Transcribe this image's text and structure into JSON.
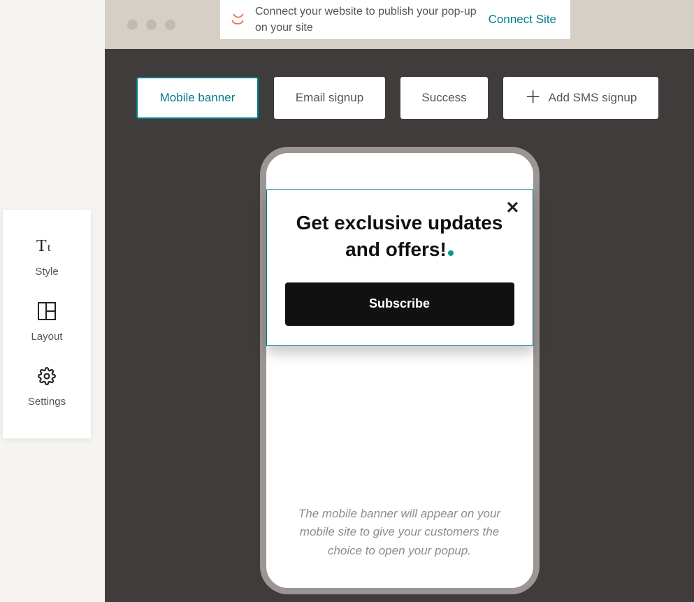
{
  "sidebar": {
    "items": [
      {
        "label": "Style"
      },
      {
        "label": "Layout"
      },
      {
        "label": "Settings"
      }
    ]
  },
  "connect": {
    "message": "Connect your website to publish your pop-up on your site",
    "link": "Connect Site"
  },
  "tabs": {
    "mobile_banner": "Mobile banner",
    "email_signup": "Email signup",
    "success": "Success",
    "add_sms": "Add SMS signup"
  },
  "banner": {
    "headline": "Get exclusive updates and offers!",
    "button": "Subscribe"
  },
  "hint": "The mobile banner will appear on your mobile site to give your customers the choice to open your popup."
}
